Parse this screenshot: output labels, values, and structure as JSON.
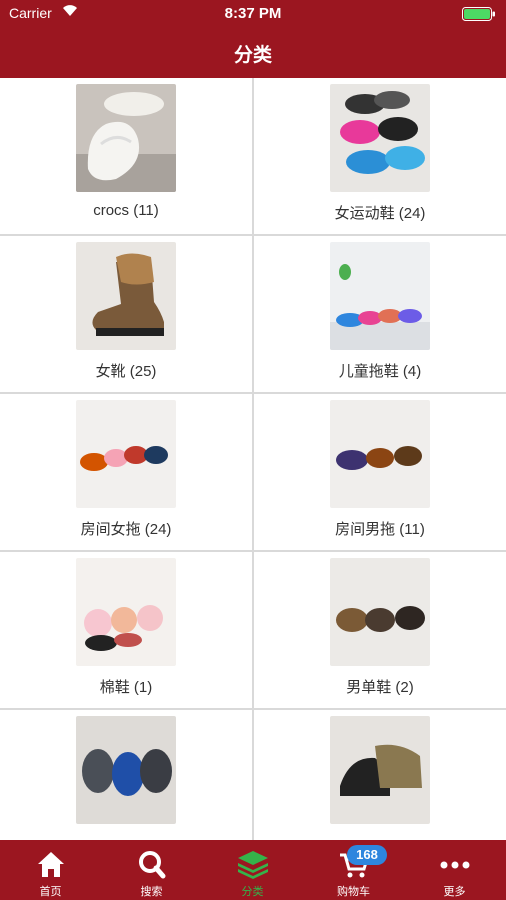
{
  "status_bar": {
    "carrier": "Carrier",
    "time": "8:37 PM"
  },
  "header": {
    "title": "分类"
  },
  "categories": [
    {
      "label": "crocs (11)",
      "icon": "white-clog-shoe-photo"
    },
    {
      "label": "女运动鞋 (24)",
      "icon": "women-sneakers-photo"
    },
    {
      "label": "女靴 (25)",
      "icon": "women-boot-photo"
    },
    {
      "label": "儿童拖鞋 (4)",
      "icon": "kids-slippers-photo"
    },
    {
      "label": "房间女拖 (24)",
      "icon": "women-room-slippers-photo"
    },
    {
      "label": "房间男拖 (11)",
      "icon": "men-room-slippers-photo"
    },
    {
      "label": "棉鞋 (1)",
      "icon": "cotton-shoes-photo"
    },
    {
      "label": "男单鞋 (2)",
      "icon": "men-leather-shoes-photo"
    },
    {
      "label": "",
      "icon": "men-sneakers-photo"
    },
    {
      "label": "",
      "icon": "hiking-shoes-photo"
    }
  ],
  "tabbar": {
    "tabs": [
      {
        "label": "首页",
        "icon": "home-icon"
      },
      {
        "label": "搜索",
        "icon": "search-icon"
      },
      {
        "label": "分类",
        "icon": "layers-icon"
      },
      {
        "label": "购物车",
        "icon": "cart-icon"
      },
      {
        "label": "更多",
        "icon": "more-icon"
      }
    ],
    "cart_badge": "168",
    "active_color": "#35b34a"
  },
  "colors": {
    "brand": "#9b1620",
    "badge": "#2e86de"
  }
}
